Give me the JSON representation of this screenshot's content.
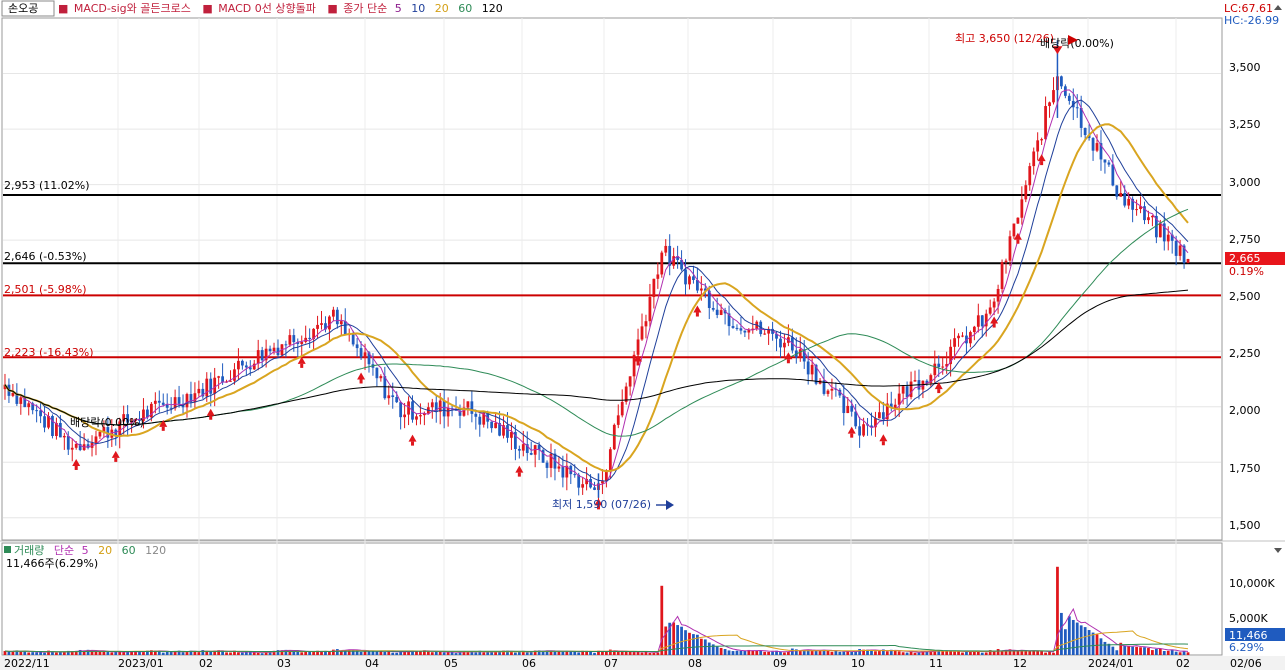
{
  "header": {
    "stock_name": "손오공",
    "indicators": [
      {
        "label": "MACD-sig와 골든크로스",
        "color": "#c0203c"
      },
      {
        "label": "MACD 0선 상향돌파",
        "color": "#c0203c"
      },
      {
        "label": "종가 단순",
        "color": "#c0203c"
      }
    ],
    "ma_periods": [
      {
        "label": "5",
        "color": "#8b1a8b"
      },
      {
        "label": "10",
        "color": "#1f3f9a"
      },
      {
        "label": "20",
        "color": "#d4a017"
      },
      {
        "label": "60",
        "color": "#2e8b57"
      },
      {
        "label": "120",
        "color": "#000000"
      }
    ],
    "lc": "LC:67.61",
    "hc": "HC:-26.99"
  },
  "volume_header": {
    "label": "거래량",
    "ma_label": "단순",
    "ma_periods": [
      "5",
      "20",
      "60",
      "120"
    ],
    "current": "11,466주(6.29%)"
  },
  "price_axis": {
    "ticks": [
      "3,500",
      "3,250",
      "3,000",
      "2,750",
      "2,500",
      "2,250",
      "2,000",
      "1,750",
      "1,500"
    ],
    "current_price": "2,665",
    "current_change": "0.19%"
  },
  "volume_axis": {
    "ticks": [
      "10,000K",
      "5,000K"
    ],
    "current_volume": "11,466",
    "current_pct": "6.29%"
  },
  "x_axis": {
    "labels": [
      "2022/11",
      "2023/01",
      "02",
      "03",
      "04",
      "05",
      "06",
      "07",
      "08",
      "09",
      "10",
      "11",
      "12",
      "2024/01",
      "02",
      "02/06"
    ]
  },
  "levels": [
    {
      "label": "2,953 (11.02%)",
      "value": 2953,
      "color": "#000000"
    },
    {
      "label": "2,646 (-0.53%)",
      "value": 2646,
      "color": "#000000"
    },
    {
      "label": "2,501 (-5.98%)",
      "value": 2501,
      "color": "#cc0000"
    },
    {
      "label": "2,223 (-16.43%)",
      "value": 2223,
      "color": "#cc0000"
    }
  ],
  "annotations": {
    "high": "최고 3,650 (12/26)",
    "low": "최저 1,590 (07/26)",
    "dividend_top": "배당락(0.00%)",
    "dividend_left": "배당락(0.00%)"
  },
  "colors": {
    "up": "#e0161c",
    "down": "#1f5bbf",
    "ma5": "#b030b0",
    "ma10": "#1f3f9a",
    "ma20": "#d9a520",
    "ma60": "#2e8b57",
    "ma120": "#000000"
  },
  "chart_data": {
    "type": "candlestick",
    "price_range": [
      1400,
      3750
    ],
    "volume_range_k": [
      0,
      14000
    ],
    "anchors": [
      {
        "x": "2022/11",
        "price": 2100,
        "volume_k": 300
      },
      {
        "x": "2022/12",
        "price": 1820,
        "volume_k": 500
      },
      {
        "x": "2023/01",
        "price": 1950,
        "volume_k": 300
      },
      {
        "x": "2023/02",
        "price": 2080,
        "volume_k": 400
      },
      {
        "x": "2023/03",
        "price": 2250,
        "volume_k": 500
      },
      {
        "x": "2023/04",
        "price": 2400,
        "volume_k": 600
      },
      {
        "x": "2023/05",
        "price": 1980,
        "volume_k": 400
      },
      {
        "x": "2023/06",
        "price": 2000,
        "volume_k": 300
      },
      {
        "x": "2023/07",
        "price": 1800,
        "volume_k": 400
      },
      {
        "x": "2023/07/26",
        "price": 1620,
        "volume_k": 500
      },
      {
        "x": "2023/08",
        "price": 2700,
        "volume_k": 10200
      },
      {
        "x": "2023/09",
        "price": 2400,
        "volume_k": 600
      },
      {
        "x": "2023/10",
        "price": 2280,
        "volume_k": 900
      },
      {
        "x": "2023/10/20",
        "price": 1900,
        "volume_k": 700
      },
      {
        "x": "2023/11",
        "price": 2150,
        "volume_k": 500
      },
      {
        "x": "2023/12",
        "price": 2420,
        "volume_k": 700
      },
      {
        "x": "2023/12/26",
        "price": 3500,
        "volume_k": 13000
      },
      {
        "x": "2024/01",
        "price": 2950,
        "volume_k": 1800
      },
      {
        "x": "2024/02/06",
        "price": 2665,
        "volume_k": 11.466
      }
    ],
    "high": 3650,
    "low": 1590,
    "last_close": 2665,
    "moving_averages": [
      "5",
      "10",
      "20",
      "60",
      "120"
    ]
  }
}
